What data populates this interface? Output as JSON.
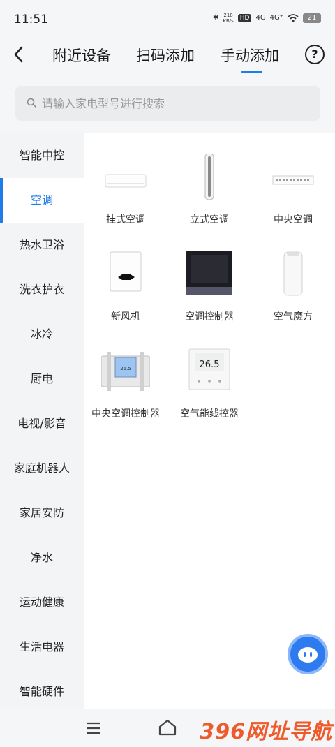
{
  "status_bar": {
    "time": "11:51",
    "bluetooth": "✱",
    "speed": "218\nKB/s",
    "hd": "HD",
    "sig1": "4G",
    "sig2": "4G⁺",
    "battery": "21"
  },
  "header": {
    "tabs": [
      {
        "label": "附近设备"
      },
      {
        "label": "扫码添加"
      },
      {
        "label": "手动添加"
      }
    ],
    "help": "?"
  },
  "search": {
    "placeholder": "请输入家电型号进行搜索"
  },
  "sidebar": {
    "items": [
      {
        "label": "智能中控"
      },
      {
        "label": "空调"
      },
      {
        "label": "热水卫浴"
      },
      {
        "label": "洗衣护衣"
      },
      {
        "label": "冰冷"
      },
      {
        "label": "厨电"
      },
      {
        "label": "电视/影音"
      },
      {
        "label": "家庭机器人"
      },
      {
        "label": "家居安防"
      },
      {
        "label": "净水"
      },
      {
        "label": "运动健康"
      },
      {
        "label": "生活电器"
      },
      {
        "label": "智能硬件"
      }
    ],
    "active_index": 1
  },
  "devices": [
    {
      "label": "挂式空调"
    },
    {
      "label": "立式空调"
    },
    {
      "label": "中央空调"
    },
    {
      "label": "新风机"
    },
    {
      "label": "空调控制器"
    },
    {
      "label": "空气魔方"
    },
    {
      "label": "中央空调控制器",
      "screen_text": "26.5"
    },
    {
      "label": "空气能线控器",
      "screen_text": "26.5"
    }
  ],
  "watermark": "396网址导航",
  "colors": {
    "accent": "#1f7ce8",
    "fab": "#2e7bf0",
    "watermark": "#ef5a2a"
  }
}
